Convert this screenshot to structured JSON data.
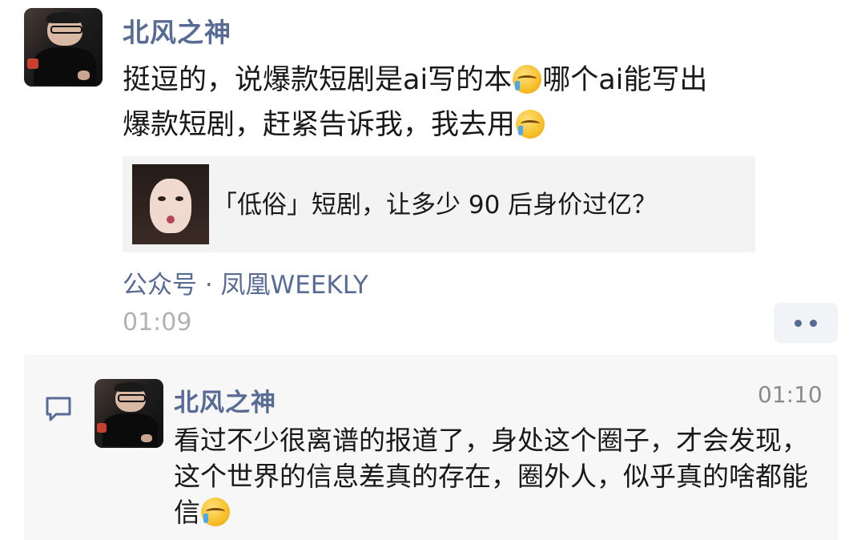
{
  "post": {
    "author": "北风之神",
    "text_line1_a": "挺逗的，说爆款短剧是ai写的本",
    "text_line1_b": "哪个ai能写出",
    "text_line2": "爆款短剧，赶紧告诉我，我去用",
    "emoji": "facepalm-cry-emoji",
    "card": {
      "title": "「低俗」短剧，让多少 90 后身价过亿？"
    },
    "source": "公众号 · 凤凰WEEKLY",
    "time": "01:09"
  },
  "reply": {
    "author": "北风之神",
    "time": "01:10",
    "text": "看过不少很离谱的报道了，身处这个圈子，才会发现，这个世界的信息差真的存在，圈外人，似乎真的啥都能信"
  },
  "colors": {
    "name_blue": "#576b95",
    "text": "#191919",
    "meta_gray": "#b2b2b2",
    "panel_bg": "#f7f7f7",
    "card_bg": "#f3f3f3"
  }
}
